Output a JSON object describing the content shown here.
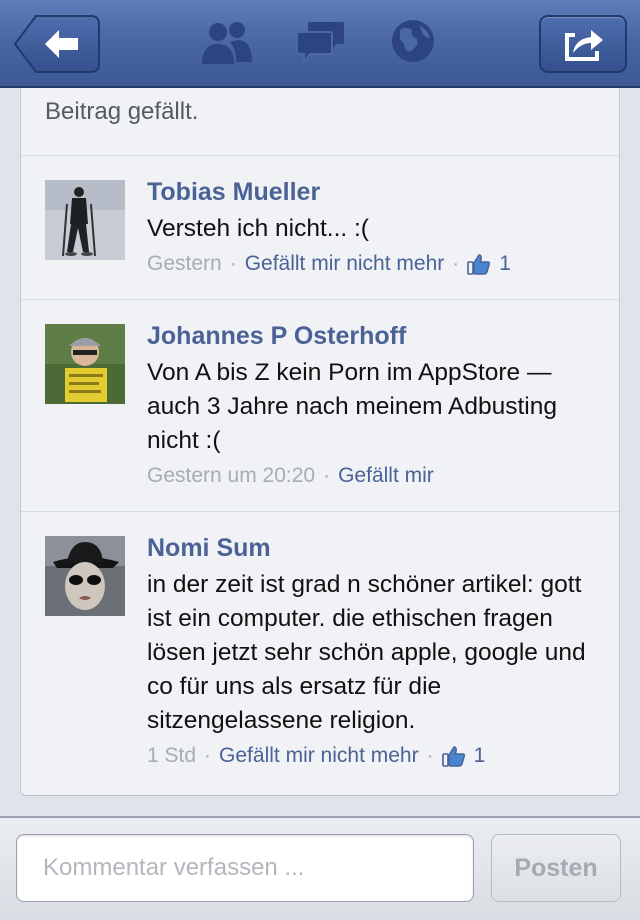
{
  "colors": {
    "navbar": "#4a68a6",
    "link": "#4a6296",
    "meta_gray": "#a7acb5",
    "card_bg": "#f0f2f6"
  },
  "navbar": {
    "back_icon": "back-arrow-icon",
    "icons": [
      "friends-icon",
      "messages-icon",
      "globe-icon"
    ],
    "share_icon": "share-icon"
  },
  "previous_comment": {
    "text": "Beitrag gefällt."
  },
  "comments": [
    {
      "author": "Tobias Mueller",
      "text": "Versteh ich nicht... :(",
      "time": "Gestern",
      "like_action": "Gefällt mir nicht mehr",
      "like_count": "1"
    },
    {
      "author": "Johannes P Osterhoff",
      "text": "Von A bis Z kein Porn im AppStore — auch 3 Jahre nach meinem Adbusting nicht :(",
      "time": "Gestern um 20:20",
      "like_action": "Gefällt mir"
    },
    {
      "author": "Nomi Sum",
      "text": "in der zeit ist grad n schöner artikel: gott ist ein computer. die ethischen fragen lösen jetzt sehr schön apple, google und co für uns als ersatz für die sitzengelassene religion.",
      "time": "1 Std",
      "like_action": "Gefällt mir nicht mehr",
      "like_count": "1"
    }
  ],
  "composer": {
    "placeholder": "Kommentar verfassen ...",
    "post_label": "Posten"
  }
}
